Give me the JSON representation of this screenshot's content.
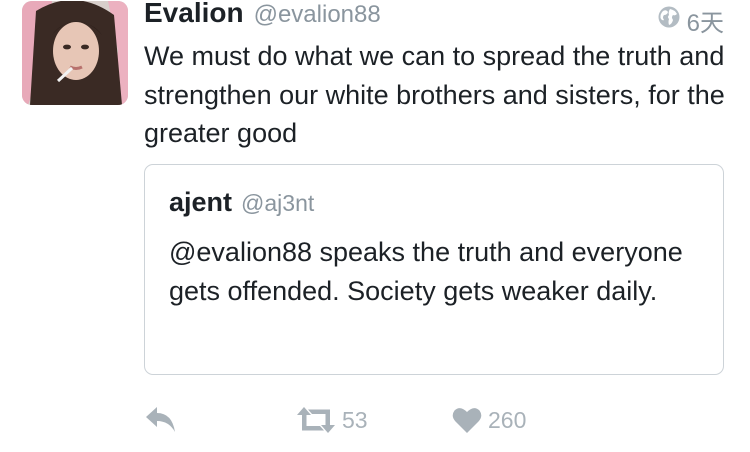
{
  "tweet": {
    "author": {
      "display_name": "Evalion",
      "handle": "@evalion88"
    },
    "timestamp": "6天",
    "privacy_icon": "globe-icon",
    "text": "We must do what we can to spread the truth and strengthen our white brothers and sisters, for the greater good",
    "quoted_tweet": {
      "display_name": "ajent",
      "handle": "@aj3nt",
      "text": "@evalion88 speaks the truth and everyone gets offended. Society gets weaker daily."
    },
    "actions": {
      "reply": {
        "icon": "reply-icon"
      },
      "retweet": {
        "icon": "retweet-icon",
        "count": "53"
      },
      "like": {
        "icon": "heart-icon",
        "count": "260"
      }
    }
  },
  "colors": {
    "text_primary": "#1c2126",
    "text_secondary": "#8a959e",
    "action_gray": "#a9b2b9",
    "border": "#cdd3d8",
    "background": "#ffffff"
  }
}
